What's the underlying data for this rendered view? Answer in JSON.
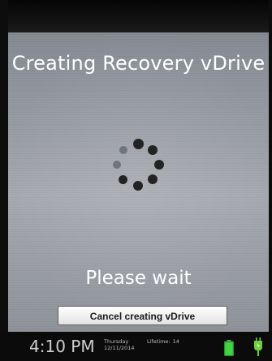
{
  "screen": {
    "title": "Creating Recovery vDrive",
    "message": "Please wait",
    "cancel_label": "Cancel creating vDrive"
  },
  "status_bar": {
    "time": "4:10 PM",
    "day": "Thursday",
    "date": "12/11/2014",
    "lifetime_label": "Lifetime:",
    "lifetime_value": "14",
    "battery_icon": "battery-icon",
    "power_icon": "power-plug-icon",
    "battery_color": "#3fbf3f"
  },
  "spinner": {
    "dot_count": 8,
    "colors": {
      "dark": "#232323",
      "light": "#70757d"
    }
  }
}
